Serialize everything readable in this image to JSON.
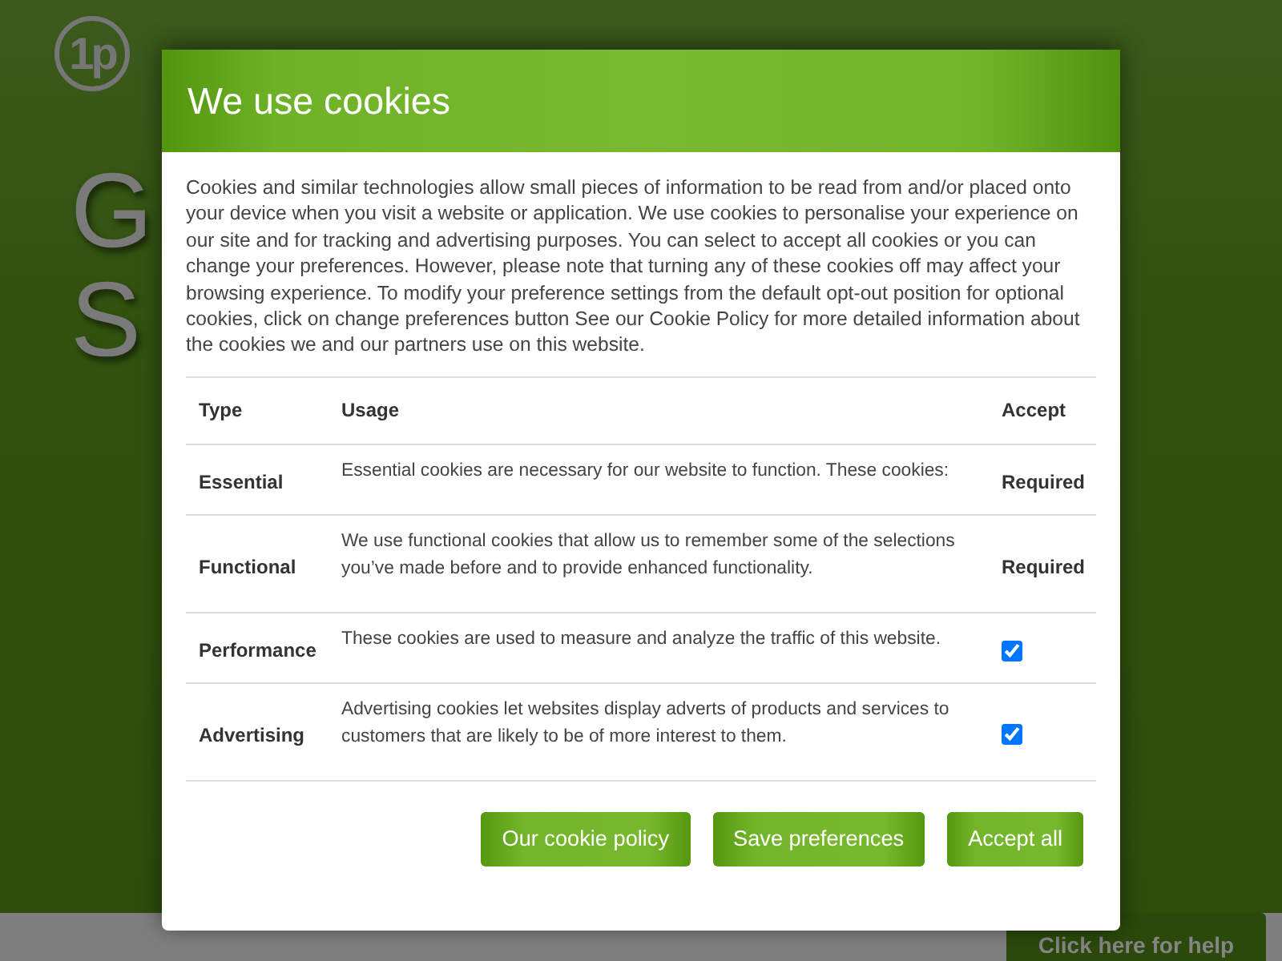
{
  "header": {
    "logo_mark": "1p"
  },
  "hero": {
    "lines": [
      "G",
      "S"
    ]
  },
  "help_button": {
    "label": "Click here for help"
  },
  "dialog": {
    "title": "We use cookies",
    "intro": "Cookies and similar technologies allow small pieces of information to be read from and/or placed onto your device when you visit a website or application. We use cookies to personalise your experience on our site and for tracking and advertising purposes. You can select to accept all cookies or you can change your preferences. However, please note that turning any of these cookies off may affect your browsing experience. To modify your preference settings from the default opt-out position for optional cookies, click on change preferences button See our Cookie Policy for more detailed information about the cookies we and our partners use on this website.",
    "table": {
      "columns": [
        "Type",
        "Usage",
        "Accept"
      ],
      "rows": [
        {
          "type": "Essential",
          "usage": "Essential cookies are necessary for our website to function. These cookies:",
          "kind": "required",
          "accept": "Required"
        },
        {
          "type": "Functional",
          "usage": "We use functional cookies that allow us to remember some of the selections you’ve made before and to provide enhanced functionality.",
          "kind": "required",
          "accept": "Required"
        },
        {
          "type": "Performance",
          "usage": "These cookies are used to measure and analyze the traffic of this website.",
          "kind": "checkbox",
          "checked": true
        },
        {
          "type": "Advertising",
          "usage": "Advertising cookies let websites display adverts of products and services to customers that are likely to be of more interest to them.",
          "kind": "checkbox",
          "checked": true
        }
      ]
    },
    "buttons": [
      "Our cookie policy",
      "Save preferences",
      "Accept all"
    ]
  }
}
